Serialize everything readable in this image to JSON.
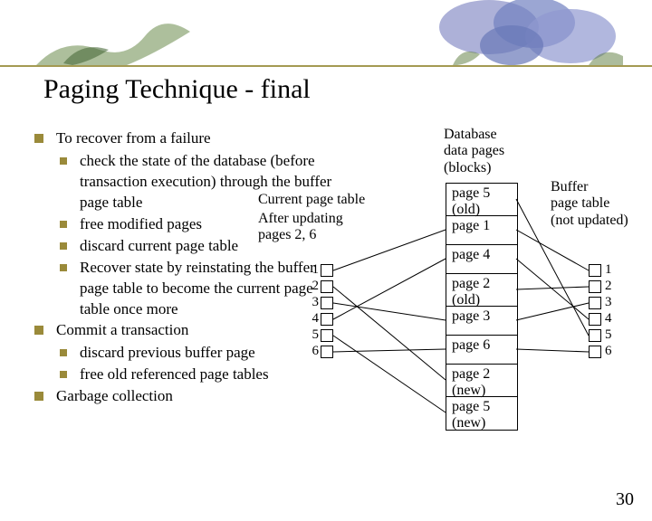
{
  "title": "Paging Technique - final",
  "bullets": {
    "b1": "To recover from a failure",
    "b1a": "check the state of the database (before transaction execution) through the buffer page table",
    "b1b": "free modified pages",
    "b1c": "discard current page table",
    "b1d": "Recover state by reinstating the buffer page table to become the current page table once more",
    "b2": "Commit a transaction",
    "b2a": "discard previous buffer page",
    "b2b": "free old referenced page tables",
    "b3": "Garbage collection"
  },
  "diagram": {
    "db_label": "Database\ndata pages\n(blocks)",
    "buf_label": "Buffer\npage table\n(not updated)",
    "cpt_label": "Current page table",
    "after_label": "After updating\npages 2, 6",
    "pages": {
      "p0": "page 5 (old)",
      "p1": "page 1",
      "p2": "page 4",
      "p3": "page 2 (old)",
      "p4": "page 3",
      "p5": "page 6",
      "p6": "page 2 (new)",
      "p7": "page 5 (new)"
    },
    "nums": [
      "1",
      "2",
      "3",
      "4",
      "5",
      "6"
    ]
  },
  "page_number": "30"
}
